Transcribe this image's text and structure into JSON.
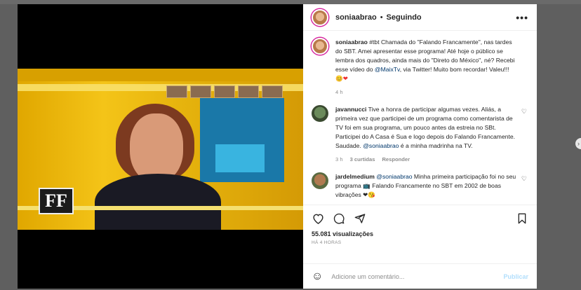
{
  "header": {
    "username": "soniaabrao",
    "separator": "•",
    "follow_status": "Seguindo",
    "more_label": "•••"
  },
  "caption": {
    "username": "soniaabrao",
    "text_before_link1": " #tbt Chamada do \"Falando Francamente\", nas tardes do SBT. Amei apresentar esse programa! Até hoje o público se lembra dos quadros, ainda mais do \"Direto do México\", né? Recebi esse vídeo do ",
    "link1": "@MaixTv",
    "text_after_link1": ", via Twitter! Muito bom recordar! Valeu!!!",
    "emojis": "😊❤",
    "time": "4 h"
  },
  "comments": [
    {
      "username": "javannucci",
      "text_before_mention": " Tive a honra de participar algumas vezes. Aliás, a primeira vez que participei de um programa como comentarista de TV foi em sua programa, um pouco antes da estreia no SBt. Participei do A Casa é Sua e logo depois do Falando Francamente. Saudade. ",
      "mention": "@soniaabrao",
      "text_after_mention": " é a minha madrinha na TV.",
      "time": "3 h",
      "likes": "3 curtidas",
      "reply": "Responder"
    },
    {
      "username": "jardelmedium",
      "mention": "@soniaabrao",
      "text": " Minha primeira participação foi no seu programa 📺 Falando Francamente no SBT em 2002 de boas vibrações ❤😘"
    }
  ],
  "actions": {
    "views": "55.081 visualizações",
    "time": "HÁ 4 HORAS"
  },
  "composer": {
    "placeholder": "Adicione um comentário...",
    "publish": "Publicar"
  },
  "video": {
    "logo_text": "FF"
  },
  "icons": {
    "like": "heart-icon",
    "comment": "comment-icon",
    "share": "share-icon",
    "save": "bookmark-icon",
    "emoji": "smile-icon",
    "next": "chevron-right-icon"
  },
  "colors": {
    "link": "#00376b",
    "muted": "#8e8e8e",
    "publish_disabled": "#b2dffc"
  }
}
